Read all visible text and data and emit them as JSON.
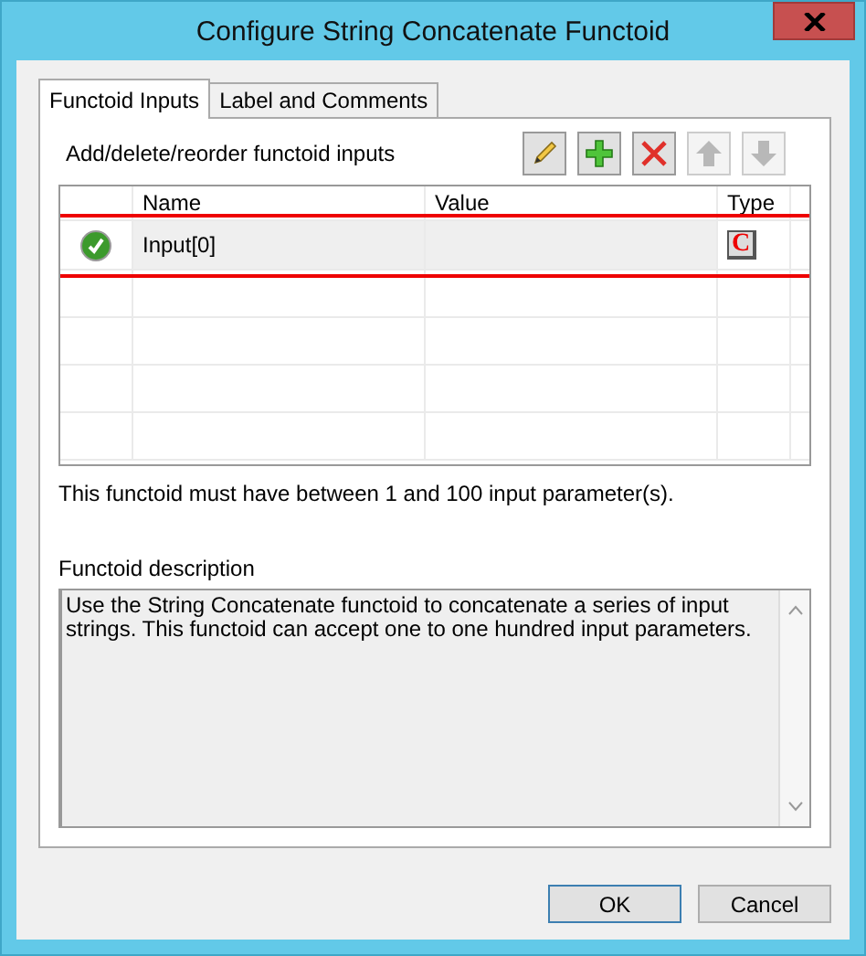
{
  "window": {
    "title": "Configure String Concatenate Functoid"
  },
  "tabs": [
    {
      "label": "Functoid Inputs",
      "selected": true
    },
    {
      "label": "Label and Comments",
      "selected": false
    }
  ],
  "inputs": {
    "caption": "Add/delete/reorder functoid inputs",
    "toolbar": [
      {
        "kind": "edit",
        "disabled": false
      },
      {
        "kind": "add",
        "disabled": false
      },
      {
        "kind": "delete",
        "disabled": false
      },
      {
        "kind": "up",
        "disabled": true
      },
      {
        "kind": "down",
        "disabled": true
      }
    ],
    "columns": [
      "Name",
      "Value",
      "Type"
    ],
    "rows": [
      {
        "valid": true,
        "name": "Input[0]",
        "type": "C",
        "highlighted": true
      }
    ],
    "note": "This functoid must have between 1 and 100 input parameter(s)."
  },
  "description": {
    "label": "Functoid description",
    "text": "Use the String Concatenate functoid to concatenate a series of input strings. This functoid can accept one to one hundred input parameters."
  },
  "buttons": [
    {
      "label": "OK",
      "default": true
    },
    {
      "label": "Cancel",
      "default": false
    }
  ]
}
